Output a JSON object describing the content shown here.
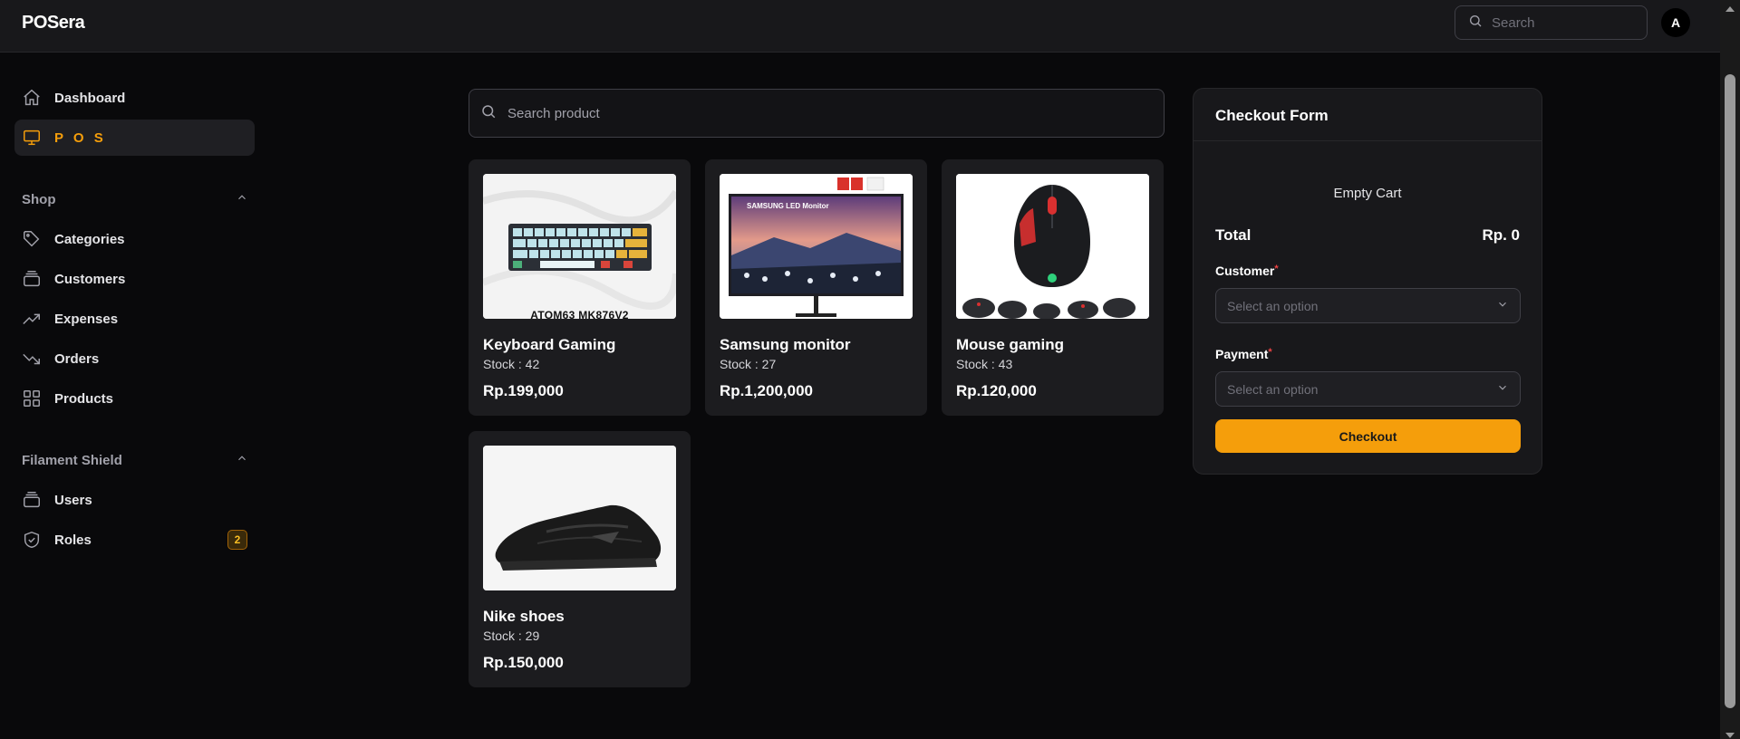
{
  "app": {
    "brand": "POSera"
  },
  "topbar": {
    "search_placeholder": "Search",
    "avatar_initial": "A"
  },
  "sidebar": {
    "items": [
      {
        "label": "Dashboard",
        "icon": "home-icon"
      },
      {
        "label": "P O S",
        "icon": "monitor-icon",
        "active": true
      }
    ],
    "groups": [
      {
        "label": "Shop",
        "items": [
          {
            "label": "Categories",
            "icon": "tag-icon"
          },
          {
            "label": "Customers",
            "icon": "stack-icon"
          },
          {
            "label": "Expenses",
            "icon": "trending-up-icon"
          },
          {
            "label": "Orders",
            "icon": "trending-down-icon"
          },
          {
            "label": "Products",
            "icon": "grid-icon"
          }
        ]
      },
      {
        "label": "Filament Shield",
        "items": [
          {
            "label": "Users",
            "icon": "stack-icon"
          },
          {
            "label": "Roles",
            "icon": "shield-check-icon",
            "badge": "2"
          }
        ]
      }
    ]
  },
  "products": {
    "search_placeholder": "Search product",
    "items": [
      {
        "name": "Keyboard Gaming",
        "stock": "Stock : 42",
        "price": "Rp.199,000",
        "image_caption": "ATOM63 MK876V2"
      },
      {
        "name": "Samsung monitor",
        "stock": "Stock : 27",
        "price": "Rp.1,200,000",
        "image_caption": "SAMSUNG LED Monitor"
      },
      {
        "name": "Mouse gaming",
        "stock": "Stock : 43",
        "price": "Rp.120,000"
      },
      {
        "name": "Nike shoes",
        "stock": "Stock : 29",
        "price": "Rp.150,000"
      }
    ]
  },
  "checkout": {
    "title": "Checkout Form",
    "empty_text": "Empty Cart",
    "total_label": "Total",
    "total_value": "Rp. 0",
    "customer_label": "Customer",
    "customer_placeholder": "Select an option",
    "payment_label": "Payment",
    "payment_placeholder": "Select an option",
    "button_label": "Checkout",
    "required_mark": "*"
  },
  "colors": {
    "accent": "#f59e0b",
    "background": "#09090b",
    "panel": "#18181b"
  }
}
